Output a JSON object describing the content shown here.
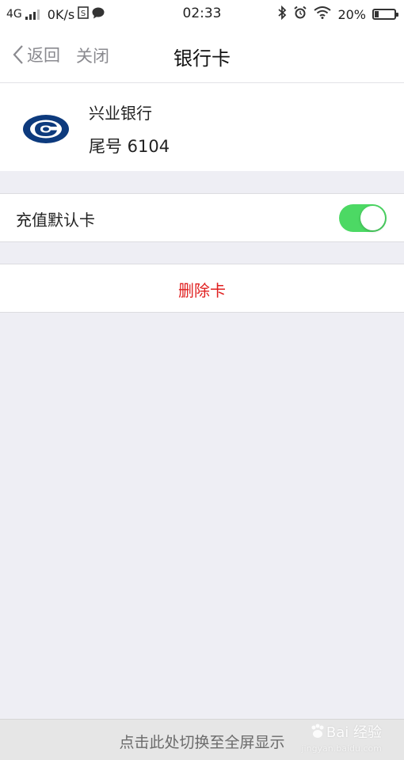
{
  "status_bar": {
    "network": "4G",
    "speed": "0K/s",
    "time": "02:33",
    "battery": "20%",
    "battery_level": 0.2
  },
  "nav": {
    "back_label": "返回",
    "close_label": "关闭",
    "title": "银行卡"
  },
  "card": {
    "bank_name": "兴业银行",
    "tail_number": "尾号 6104",
    "logo_color": "#0d3a7d"
  },
  "settings": {
    "default_card_label": "充值默认卡",
    "default_card_enabled": true,
    "toggle_color": "#4cd964"
  },
  "actions": {
    "delete_label": "删除卡",
    "delete_color": "#e02020"
  },
  "bottom_bar": {
    "fullscreen_label": "点击此处切换至全屏显示",
    "watermark_text": "Bai 经验",
    "watermark_sub": "jingyan.baidu.com"
  }
}
